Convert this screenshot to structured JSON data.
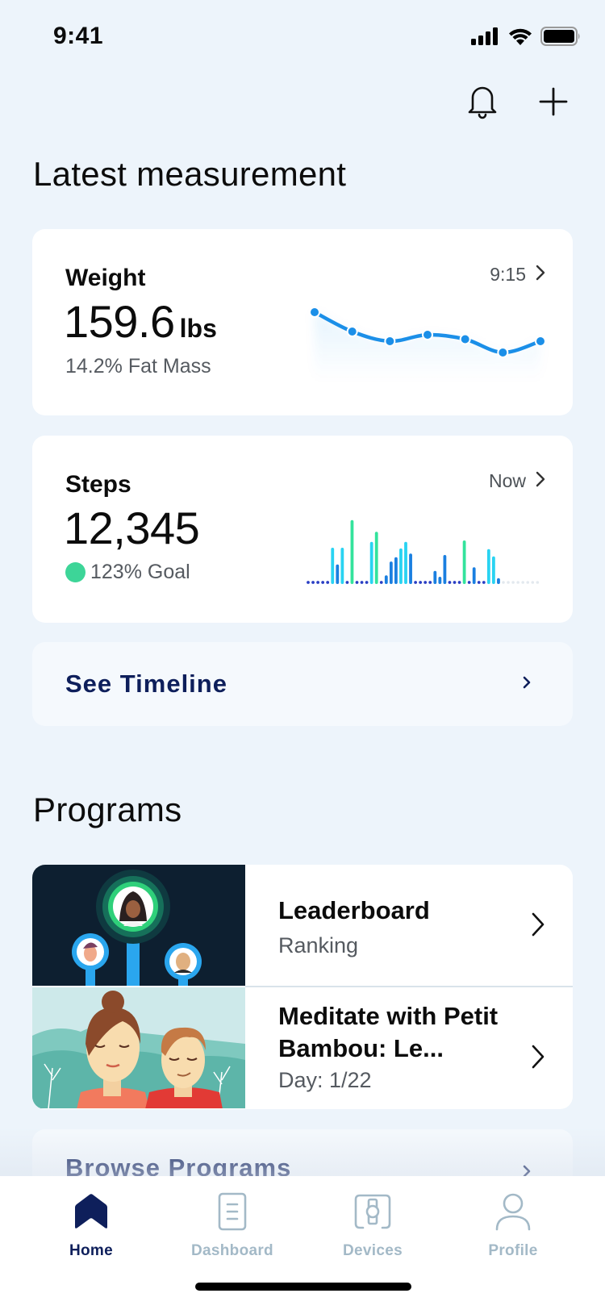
{
  "status_bar": {
    "time": "9:41",
    "icons": [
      "cellular-signal-icon",
      "wifi-icon",
      "battery-icon"
    ]
  },
  "header": {
    "actions": [
      "bell-icon",
      "plus-icon"
    ]
  },
  "latest": {
    "title": "Latest measurement",
    "weight": {
      "label": "Weight",
      "value": "159.6",
      "unit": "lbs",
      "sub": "14.2% Fat Mass",
      "time": "9:15",
      "line_color": "#1b8fe8"
    },
    "steps": {
      "label": "Steps",
      "value": "12,345",
      "goal": "123% Goal",
      "goal_color": "#3dd598",
      "time": "Now"
    },
    "timeline_link": "See Timeline"
  },
  "programs": {
    "title": "Programs",
    "items": [
      {
        "title": "Leaderboard",
        "subtitle": "Ranking"
      },
      {
        "title": "Meditate with Petit Bambou: Le...",
        "subtitle": "Day: 1/22"
      }
    ],
    "browse_link": "Browse Programs"
  },
  "tabbar": {
    "active": "Home",
    "tabs": [
      {
        "label": "Home",
        "icon": "home-icon"
      },
      {
        "label": "Dashboard",
        "icon": "dashboard-icon"
      },
      {
        "label": "Devices",
        "icon": "watch-device-icon"
      },
      {
        "label": "Profile",
        "icon": "profile-icon"
      }
    ],
    "active_color": "#0e1f5b",
    "inactive_color": "#a3b9c7"
  },
  "chart_data": [
    {
      "type": "line",
      "title": "Weight trend",
      "note": "sparkline, no axes shown; relative levels (higher = heavier)",
      "x": [
        1,
        2,
        3,
        4,
        5,
        6,
        7
      ],
      "values": [
        100,
        52,
        28,
        44,
        33,
        0,
        28
      ],
      "ylim": [
        0,
        100
      ],
      "color": "#1b8fe8"
    },
    {
      "type": "bar",
      "title": "Steps today",
      "note": "48 time slots; 0 = dot only; null = future slot (light grey dot); relative heights",
      "values": [
        0,
        0,
        0,
        0,
        0,
        50,
        27,
        50,
        0,
        88,
        0,
        0,
        0,
        58,
        72,
        0,
        12,
        31,
        37,
        49,
        58,
        42,
        0,
        0,
        0,
        0,
        18,
        10,
        40,
        0,
        0,
        0,
        60,
        0,
        23,
        0,
        0,
        48,
        38,
        8,
        null,
        null,
        null,
        null,
        null,
        null,
        null,
        null
      ],
      "levels": [
        "low",
        "low",
        "low",
        "low",
        "low",
        "mid",
        "low",
        "mid",
        "low",
        "high",
        "low",
        "low",
        "low",
        "mid",
        "high",
        "low",
        "low",
        "low",
        "low",
        "mid",
        "mid",
        "low",
        "low",
        "low",
        "low",
        "low",
        "low",
        "low",
        "low",
        "low",
        "low",
        "low",
        "high",
        "low",
        "low",
        "low",
        "low",
        "mid",
        "mid",
        "low",
        "future",
        "future",
        "future",
        "future",
        "future",
        "future",
        "future",
        "future"
      ],
      "colors": {
        "low": "#1a7fe0",
        "mid": "#29d3f2",
        "high": "#33e39c",
        "baseline_dot": "#2a3fc4",
        "future": "#e3e9ef"
      },
      "ylim": [
        0,
        100
      ]
    }
  ]
}
